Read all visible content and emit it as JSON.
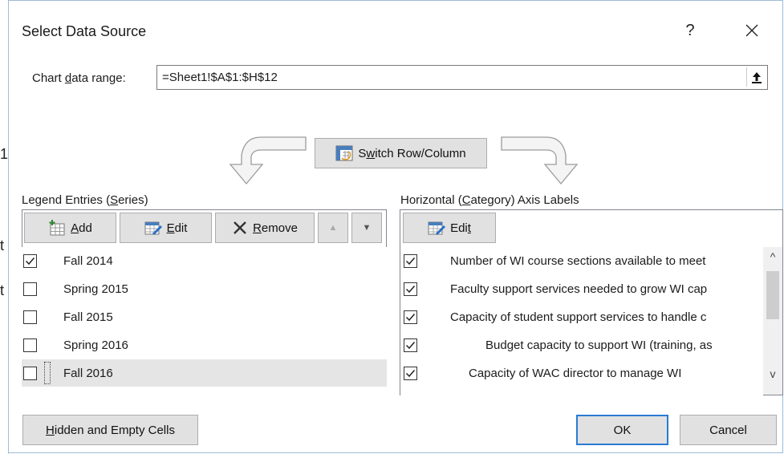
{
  "dialog": {
    "title": "Select Data Source",
    "help_glyph": "?",
    "close_glyph": "✕"
  },
  "data_range": {
    "label_pre": "Chart ",
    "label_acc": "d",
    "label_post": "ata range:",
    "value": "=Sheet1!$A$1:$H$12",
    "collapse_glyph": "⭱"
  },
  "switch_button": {
    "pre": "S",
    "acc": "w",
    "post": "itch Row/Column"
  },
  "legend": {
    "heading_pre": "Legend Entries (",
    "heading_acc": "S",
    "heading_post": "eries)",
    "add": {
      "acc": "A",
      "post": "dd"
    },
    "edit": {
      "acc": "E",
      "post": "dit"
    },
    "remove": {
      "acc": "R",
      "post": "emove"
    },
    "up_glyph": "▲",
    "down_glyph": "▼",
    "items": [
      {
        "label": "Fall 2014",
        "checked": true
      },
      {
        "label": "Spring 2015",
        "checked": false
      },
      {
        "label": "Fall 2015",
        "checked": false
      },
      {
        "label": "Spring 2016",
        "checked": false
      },
      {
        "label": "Fall 2016",
        "checked": false
      }
    ]
  },
  "axis": {
    "heading_pre": "Horizontal (",
    "heading_acc": "C",
    "heading_post": "ategory) Axis Labels",
    "edit": {
      "pre": "Edi",
      "acc": "t"
    },
    "items": [
      {
        "label": "Number of WI course sections available to meet",
        "checked": true
      },
      {
        "label": "Faculty support services needed to grow WI cap",
        "checked": true
      },
      {
        "label": "Capacity of student support services to handle c",
        "checked": true
      },
      {
        "label": "Budget capacity to support WI (training, as",
        "checked": true
      },
      {
        "label": "Capacity of WAC director to manage WI",
        "checked": true
      }
    ],
    "scroll_up_glyph": "^",
    "scroll_down_glyph": "v"
  },
  "footer": {
    "hidden_cells": {
      "acc": "H",
      "post": "idden and Empty Cells"
    },
    "ok": "OK",
    "cancel": "Cancel"
  },
  "colors": {
    "accent": "#2a7ad5",
    "selected_row": "#e5e5e5",
    "scrollbar_thumb": "#cdcdcd"
  }
}
